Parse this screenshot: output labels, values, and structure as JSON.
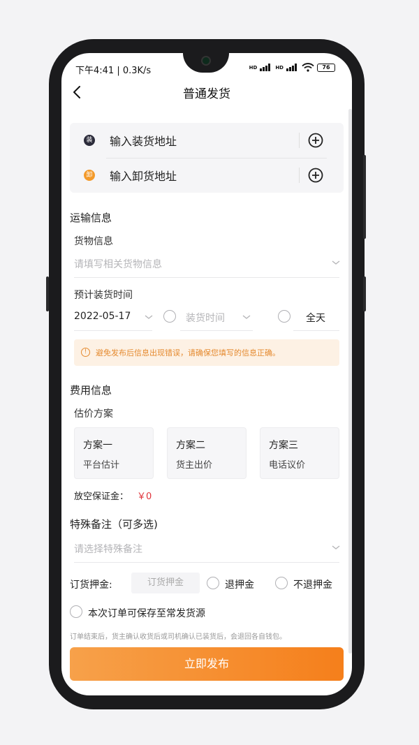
{
  "status_bar": {
    "time_speed": "下午4:41 | 0.3K/s",
    "net1": "HD",
    "net2": "HD",
    "battery": "76"
  },
  "header": {
    "title": "普通发货",
    "back_icon": "chevron-left-icon"
  },
  "address": {
    "load": {
      "badge": "装",
      "placeholder": "输入装货地址",
      "badge_color": "#2b2b3a"
    },
    "unload": {
      "badge": "卸",
      "placeholder": "输入卸货地址",
      "badge_color": "#f39a2b"
    }
  },
  "transport": {
    "section_title": "运输信息",
    "goods_label": "货物信息",
    "goods_placeholder": "请填写相关货物信息",
    "time_label": "预计装货时间",
    "date_value": "2022-05-17",
    "time_placeholder": "装货时间",
    "all_day_label": "全天"
  },
  "warning": {
    "icon": "!",
    "text": "避免发布后信息出现错误，请确保您填写的信息正确。"
  },
  "fees": {
    "section_title": "费用信息",
    "plan_label": "估价方案",
    "plans": [
      {
        "name": "方案一",
        "desc": "平台估计"
      },
      {
        "name": "方案二",
        "desc": "货主出价"
      },
      {
        "name": "方案三",
        "desc": "电话议价"
      }
    ],
    "empty_deposit_label": "放空保证金：",
    "empty_deposit_value": "￥0"
  },
  "remarks": {
    "section_title": "特殊备注（可多选)",
    "placeholder": "请选择特殊备注"
  },
  "deposit": {
    "label": "订货押金:",
    "input_placeholder": "订货押金",
    "refund_label": "退押金",
    "no_refund_label": "不退押金"
  },
  "save_label": "本次订单可保存至常发货源",
  "note": "订单结束后，货主确认收货后或司机确认已装货后，会退回各自钱包。",
  "submit_label": "立即发布",
  "colors": {
    "accent": "#f57f1b",
    "warning_bg": "#fdf1e4",
    "price_red": "#e0343b"
  }
}
